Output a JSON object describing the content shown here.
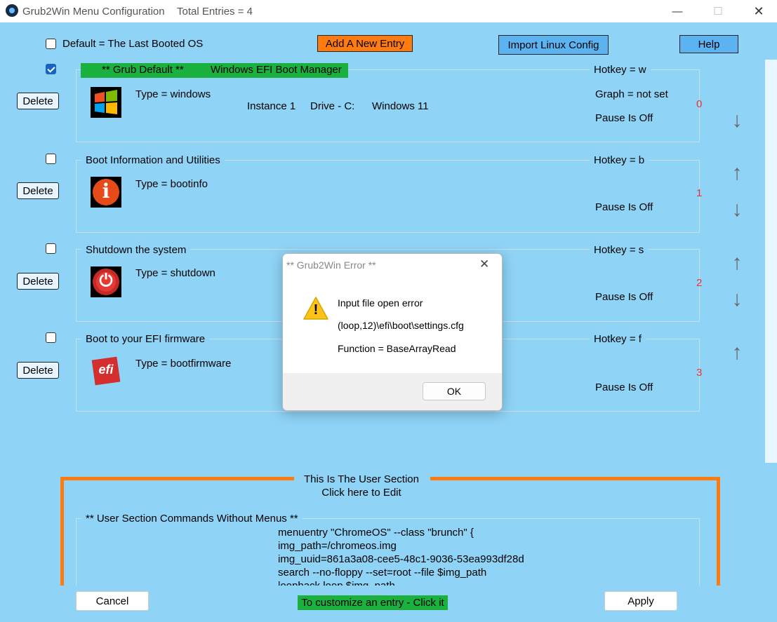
{
  "window": {
    "title": "Grub2Win Menu Configuration",
    "total_entries": "Total Entries = 4",
    "min_glyph": "—",
    "max_glyph": "☐",
    "close_glyph": "✕"
  },
  "toolbar": {
    "default_last_booted": "Default = The Last Booted OS",
    "add_entry": "Add A New Entry",
    "import_linux": "Import Linux Config",
    "help": "Help"
  },
  "entries": [
    {
      "checked": true,
      "title": "** Grub Default **",
      "title2": "Windows EFI Boot Manager",
      "hotkey": "Hotkey = w",
      "type": "Type = windows",
      "instance": "Instance 1",
      "drive": "Drive - C:",
      "os": "Windows 11",
      "graph": "Graph = not set",
      "pause": "Pause Is Off",
      "index": "0",
      "delete_label": "Delete"
    },
    {
      "checked": false,
      "title": "Boot Information and Utilities",
      "hotkey": "Hotkey = b",
      "type": "Type = bootinfo",
      "pause": "Pause Is Off",
      "index": "1",
      "delete_label": "Delete"
    },
    {
      "checked": false,
      "title": "Shutdown the system",
      "hotkey": "Hotkey = s",
      "type": "Type = shutdown",
      "pause": "Pause Is Off",
      "index": "2",
      "delete_label": "Delete"
    },
    {
      "checked": false,
      "title": "Boot to your EFI firmware",
      "hotkey": "Hotkey = f",
      "type": "Type = bootfirmware",
      "pause": "Pause Is Off",
      "index": "3",
      "delete_label": "Delete"
    }
  ],
  "arrows": {
    "up": "↑",
    "down": "↓"
  },
  "icons": {
    "windows": "windows-logo-icon",
    "bootinfo": "info-icon",
    "shutdown": "power-icon",
    "efi": "efi-logo-icon",
    "info_glyph": "i",
    "power_glyph": "⏻",
    "efi_glyph": "efi"
  },
  "dialog": {
    "title": "** Grub2Win Error **",
    "close_glyph": "✕",
    "warning_glyph": "!",
    "line1": "Input file open error",
    "line2": "(loop,12)\\efi\\boot\\settings.cfg",
    "line3": "Function = BaseArrayRead",
    "ok": "OK"
  },
  "user_section": {
    "title": "This Is The User Section",
    "subtitle": "Click here to Edit",
    "commands_label": "** User Section Commands Without Menus **",
    "code_lines": [
      "menuentry \"ChromeOS\" --class \"brunch\" {",
      "img_path=/chromeos.img",
      "img_uuid=861a3a08-cee5-48c1-9036-53ea993df28d",
      "search --no-floppy --set=root --file $img_path",
      "loopback loop $img_path"
    ]
  },
  "bottom": {
    "cancel": "Cancel",
    "customize": "To customize an entry - Click it",
    "apply": "Apply"
  },
  "colors": {
    "background": "#8fd3f6",
    "accent_orange": "#ff7a0f",
    "accent_green": "#1bb13f",
    "button_blue": "#5bb3f2",
    "index_red": "#e33333"
  }
}
